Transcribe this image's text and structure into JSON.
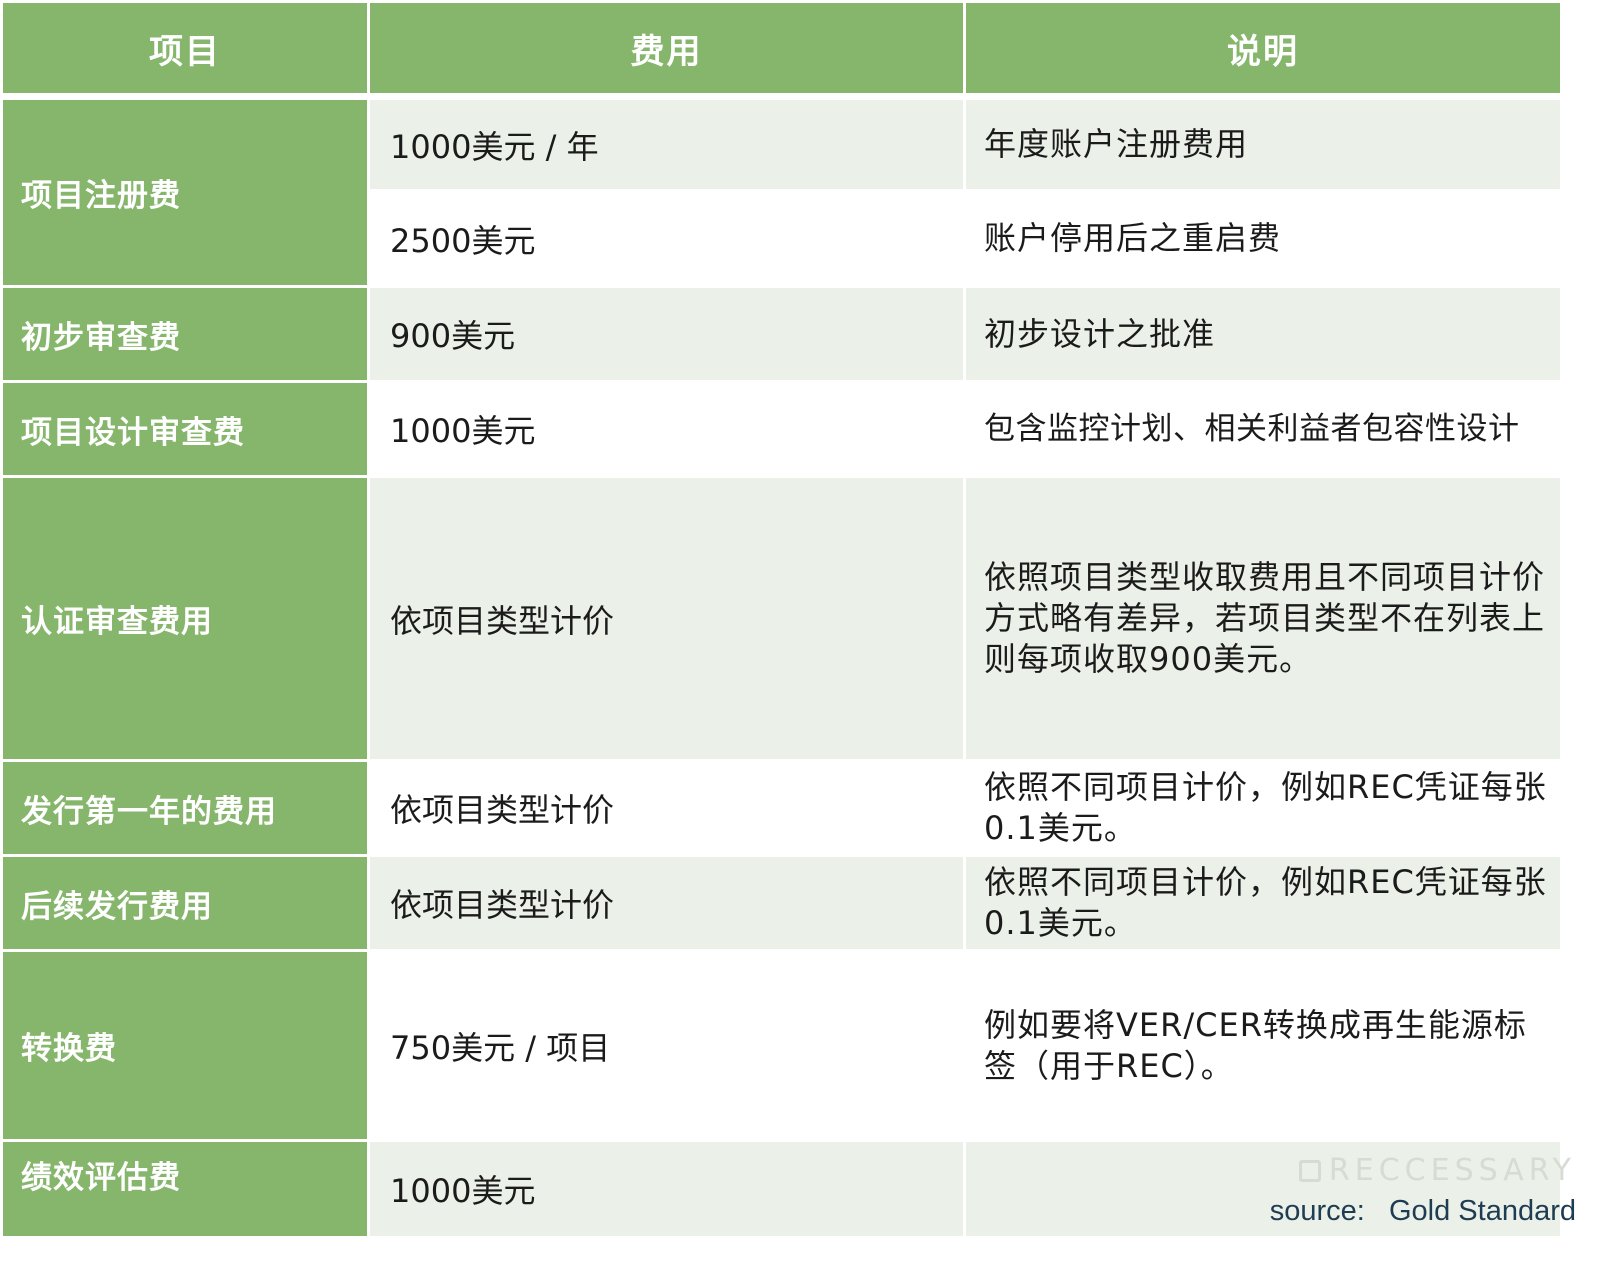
{
  "header": {
    "item": "项目",
    "fee": "费用",
    "desc": "说明"
  },
  "rows": [
    {
      "item": "项目注册费",
      "fee": "1000美元 / 年",
      "desc": "年度账户注册费用"
    },
    {
      "fee": "2500美元",
      "desc": "账户停用后之重启费"
    },
    {
      "item": "初步审查费",
      "fee": "900美元",
      "desc": "初步设计之批准"
    },
    {
      "item": "项目设计审查费",
      "fee": "1000美元",
      "desc": "包含监控计划、相关利益者包容性设计"
    },
    {
      "item": "认证审查费用",
      "fee": "依项目类型计价",
      "desc_lines": [
        "依照项目类型收取费用且不同项目计价",
        "方式略有差异，若项目类型不在列表上",
        "则每项收取900美元。"
      ]
    },
    {
      "item": "发行第一年的费用",
      "fee": "依项目类型计价",
      "desc_lines": [
        "依照不同项目计价，例如REC凭证每张",
        "0.1美元。"
      ]
    },
    {
      "item": "后续发行费用",
      "fee": "依项目类型计价",
      "desc_lines": [
        "依照不同项目计价，例如REC凭证每张",
        "0.1美元。"
      ]
    },
    {
      "item": "转换费",
      "fee": "750美元 / 项目",
      "desc_lines": [
        "例如要将VER/CER转换成再生能源标",
        "签（用于REC）。"
      ]
    },
    {
      "item": "绩效评估费",
      "fee": "1000美元",
      "desc": ""
    }
  ],
  "watermark": "RECCESSARY",
  "source": "source:   Gold Standard",
  "colors": {
    "header_bg": "#86b66c",
    "item_bg": "#86b66c",
    "light_row": "#ebf0e8",
    "text": "#1b1b1b"
  }
}
